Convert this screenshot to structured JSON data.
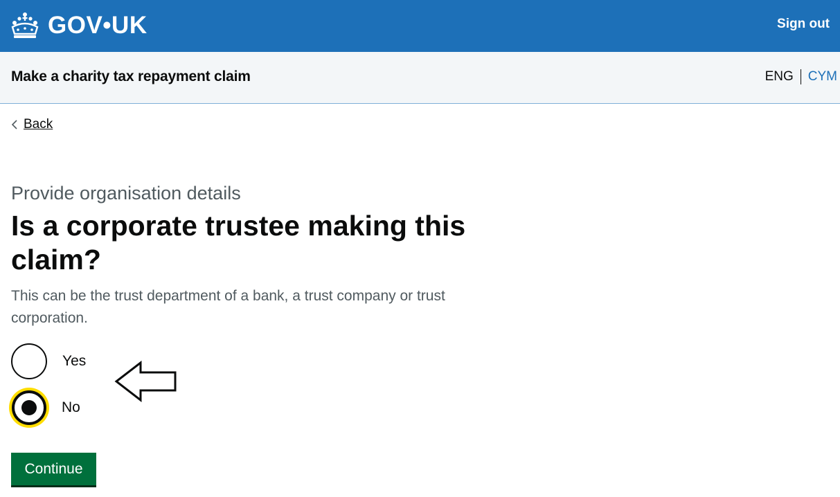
{
  "header": {
    "logo_text": "GOV•UK",
    "sign_out_label": "Sign out"
  },
  "service": {
    "name": "Make a charity tax repayment claim",
    "lang_current": "ENG",
    "lang_other": "CYM"
  },
  "nav": {
    "back_label": "Back"
  },
  "main": {
    "caption": "Provide organisation details",
    "heading": "Is a corporate trustee making this claim?",
    "hint": "This can be the trust department of a bank, a trust company or trust corporation.",
    "options": [
      {
        "label": "Yes",
        "selected": false
      },
      {
        "label": "No",
        "selected": true
      }
    ],
    "continue_label": "Continue"
  },
  "colors": {
    "header_blue": "#1d70b8",
    "service_bg": "#f3f6f8",
    "button_green": "#00703c",
    "focus_yellow": "#ffdd00",
    "text_secondary": "#505a5f"
  }
}
